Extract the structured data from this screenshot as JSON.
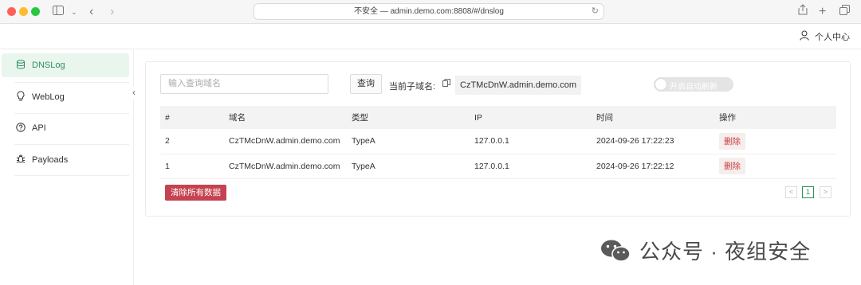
{
  "browser": {
    "url": "不安全 — admin.demo.com:8808/#/dnslog"
  },
  "header": {
    "user_center": "个人中心"
  },
  "sidebar": {
    "items": [
      {
        "label": "DNSLog",
        "icon": "database-icon",
        "active": true
      },
      {
        "label": "WebLog",
        "icon": "lightbulb-icon",
        "active": false
      },
      {
        "label": "API",
        "icon": "help-circle-icon",
        "active": false
      },
      {
        "label": "Payloads",
        "icon": "bug-icon",
        "active": false
      }
    ]
  },
  "toolbar": {
    "search_placeholder": "输入查询域名",
    "query_label": "查询",
    "subdomain_label": "当前子域名:",
    "subdomain_value": "CzTMcDnW.admin.demo.com",
    "auto_refresh_label": "开启自动刷新",
    "auto_refresh_on": false
  },
  "table": {
    "columns": [
      "#",
      "域名",
      "类型",
      "IP",
      "时间",
      "操作"
    ],
    "rows": [
      {
        "id": "2",
        "domain": "CzTMcDnW.admin.demo.com",
        "type": "TypeA",
        "ip": "127.0.0.1",
        "time": "2024-09-26 17:22:23",
        "action": "删除"
      },
      {
        "id": "1",
        "domain": "CzTMcDnW.admin.demo.com",
        "type": "TypeA",
        "ip": "127.0.0.1",
        "time": "2024-09-26 17:22:12",
        "action": "删除"
      }
    ]
  },
  "footer": {
    "clear_label": "清除所有数据",
    "page_prev": "<",
    "page_current": "1",
    "page_next": ">"
  },
  "watermark": {
    "text": "公众号 · 夜组安全"
  },
  "colors": {
    "accent": "#2f8f5a",
    "danger": "#c54250"
  }
}
